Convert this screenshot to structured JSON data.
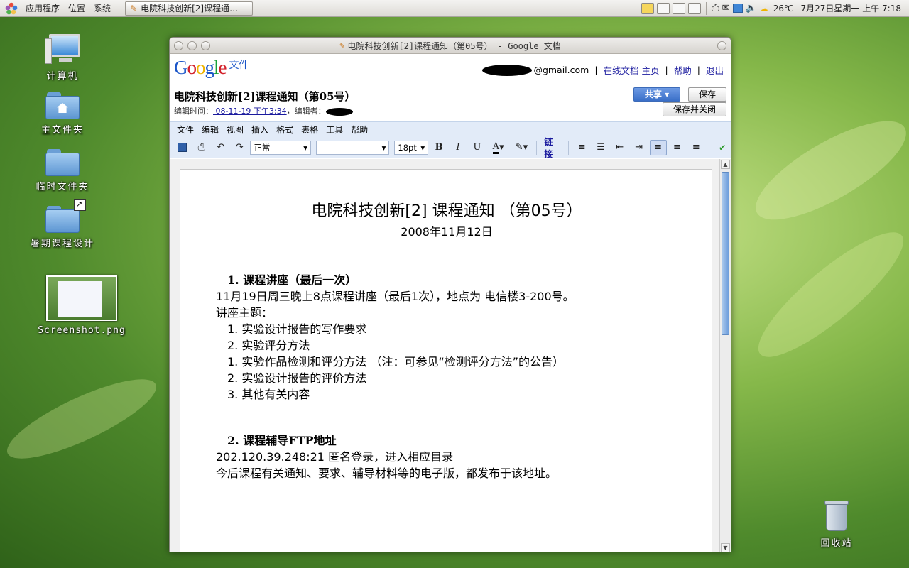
{
  "panel": {
    "menus": [
      "应用程序",
      "位置",
      "系统"
    ],
    "task_title": "电院科技创新[2]课程通…",
    "weather": "26℃",
    "clock": "7月27日星期一 上午 7:18"
  },
  "desktop": {
    "icons": [
      {
        "label": "计算机"
      },
      {
        "label": "主文件夹"
      },
      {
        "label": "临时文件夹"
      },
      {
        "label": "暑期课程设计"
      },
      {
        "label": "Screenshot.png"
      },
      {
        "label": "回收站"
      }
    ]
  },
  "window": {
    "title": "电院科技创新[2]课程通知（第05号） - Google 文档",
    "logo_suffix": "文件",
    "user_email": "@gmail.com",
    "links": [
      "在线文档 主页",
      "帮助",
      "退出"
    ],
    "doc_title": "电院科技创新[2]课程通知（第05号）",
    "edit_time_label": "编辑时间：",
    "edit_time": " 08-11-19 下午3:34",
    "editor_label": "，编辑者：",
    "share_label": "共享 ▾",
    "save_label": "保存",
    "save_close_label": "保存并关闭",
    "menu": [
      "文件",
      "编辑",
      "视图",
      "插入",
      "格式",
      "表格",
      "工具",
      "帮助"
    ],
    "toolbar": {
      "style": "正常",
      "font": "",
      "size": "18pt",
      "link": "链接"
    }
  },
  "document": {
    "heading": "电院科技创新[2] 课程通知 （第05号）",
    "date": "2008年11月12日",
    "section1_title": "1. 课程讲座（最后一次）",
    "p1": "11月19日周三晚上8点课程讲座（最后1次），地点为 电信楼3-200号。",
    "p2": "讲座主题：",
    "list1": [
      "1. 实验设计报告的写作要求",
      "2. 实验评分方法",
      "1. 实验作品检测和评分方法 （注：可参见“检测评分方法”的公告）",
      "2. 实验设计报告的评价方法",
      "3. 其他有关内容"
    ],
    "section2_title": "2. 课程辅导FTP地址",
    "p3": "202.120.39.248:21 匿名登录，进入相应目录",
    "p4": "今后课程有关通知、要求、辅导材料等的电子版，都发布于该地址。"
  }
}
